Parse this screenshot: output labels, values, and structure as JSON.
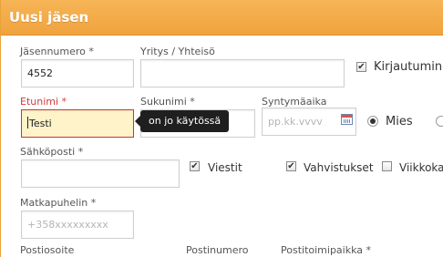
{
  "dialog": {
    "title": "Uusi jäsen"
  },
  "form": {
    "member_number": {
      "label": "Jäsennumero *",
      "value": "4552"
    },
    "company": {
      "label": "Yritys / Yhteisö",
      "value": ""
    },
    "login_checkbox": {
      "label": "Kirjautuminen",
      "checked": true
    },
    "first_name": {
      "label": "Etunimi *",
      "value": "Testi",
      "error": "on jo käytössä"
    },
    "last_name": {
      "label": "Sukunimi *",
      "value": ""
    },
    "birthdate": {
      "label": "Syntymäaika",
      "placeholder": "pp.kk.vvvv"
    },
    "gender_male": {
      "label": "Mies",
      "selected": true
    },
    "email": {
      "label": "Sähköposti *",
      "value": ""
    },
    "messages_checkbox": {
      "label": "Viestit",
      "checked": true
    },
    "confirmations_checkbox": {
      "label": "Vahvistukset",
      "checked": true
    },
    "weekly_checkbox": {
      "label": "Viikkokatsaus",
      "checked": false
    },
    "mobile": {
      "label": "Matkapuhelin *",
      "placeholder": "+358xxxxxxxxx"
    },
    "postal_address": {
      "label": "Postiosoite"
    },
    "postal_code": {
      "label": "Postinumero"
    },
    "post_office": {
      "label": "Postitoimipaikka *"
    }
  },
  "colors": {
    "header": "#f0a33d",
    "error_border": "#c23a3a",
    "error_bg": "#fff3c9",
    "tooltip_bg": "#1f1f1f"
  }
}
